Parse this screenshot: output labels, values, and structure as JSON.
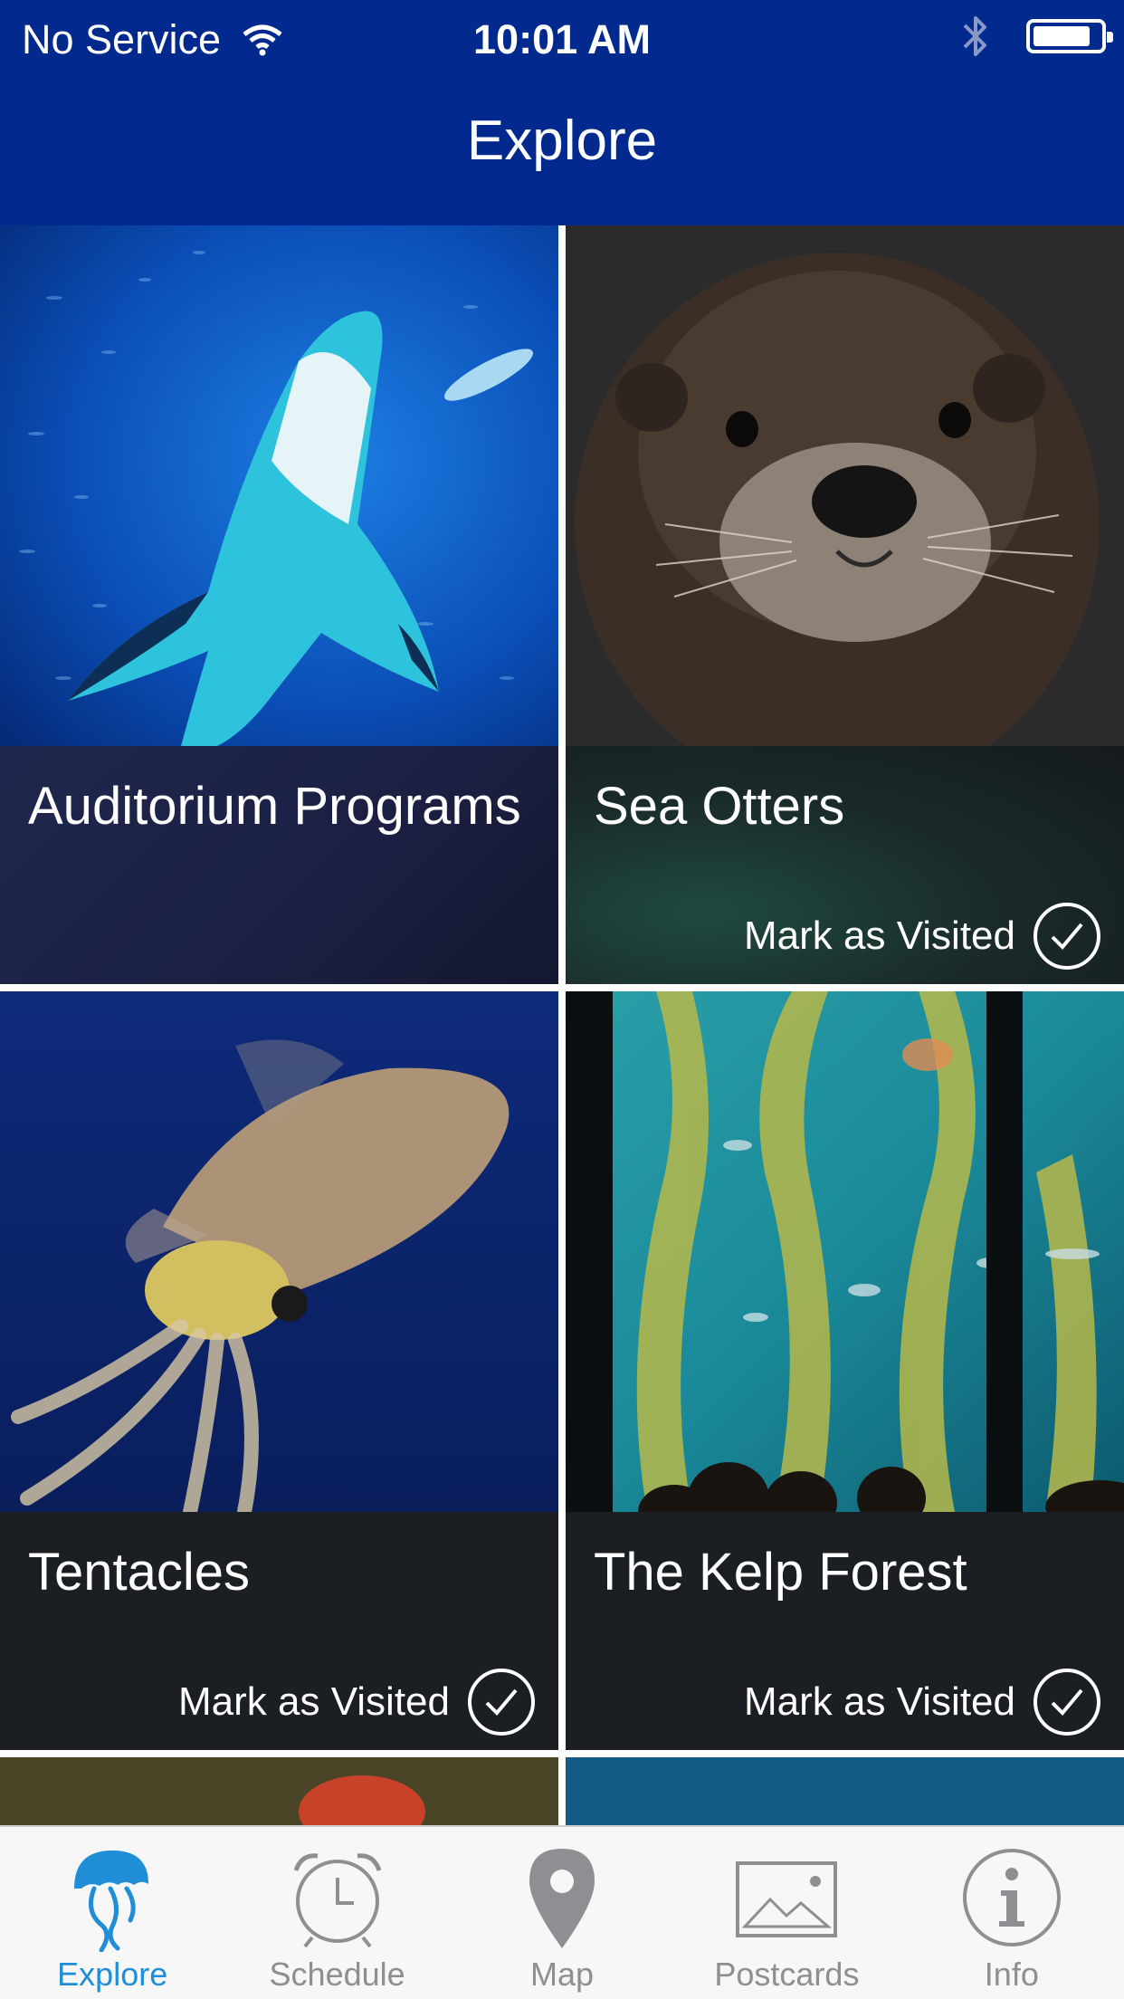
{
  "status_bar": {
    "carrier": "No Service",
    "time": "10:01 AM",
    "icons": [
      "wifi-icon",
      "bluetooth-icon",
      "battery-icon"
    ]
  },
  "nav": {
    "title": "Explore"
  },
  "tiles": [
    {
      "title": "Auditorium Programs",
      "photo": "shark",
      "mark_visited": ""
    },
    {
      "title": "Sea Otters",
      "photo": "otter",
      "mark_visited": "Mark as Visited"
    },
    {
      "title": "Tentacles",
      "photo": "squid",
      "mark_visited": "Mark as Visited"
    },
    {
      "title": "The Kelp Forest",
      "photo": "kelp-forest",
      "mark_visited": "Mark as Visited"
    }
  ],
  "tabs": [
    {
      "label": "Explore",
      "icon": "jellyfish-icon",
      "active": true
    },
    {
      "label": "Schedule",
      "icon": "alarm-clock-icon",
      "active": false
    },
    {
      "label": "Map",
      "icon": "map-pin-icon",
      "active": false
    },
    {
      "label": "Postcards",
      "icon": "picture-icon",
      "active": false
    },
    {
      "label": "Info",
      "icon": "info-icon",
      "active": false
    }
  ],
  "colors": {
    "nav_bar": "#022a8e",
    "tab_active": "#1f8ed6",
    "tab_inactive": "#8e8e93"
  }
}
